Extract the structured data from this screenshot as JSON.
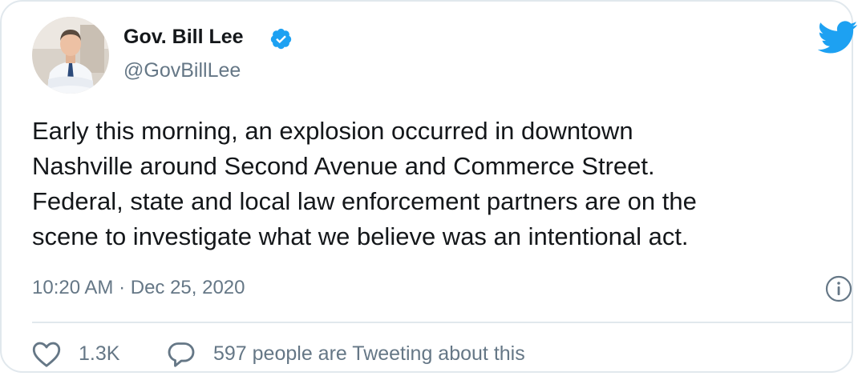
{
  "author": {
    "display_name": "Gov. Bill Lee",
    "handle": "@GovBillLee",
    "verified": true,
    "avatar_icon": "person-photo"
  },
  "tweet": {
    "text": "Early this morning, an explosion occurred in downtown\nNashville around Second Avenue and Commerce Street.\nFederal, state and local law enforcement partners are on the\nscene to investigate what we believe was an intentional act.",
    "timestamp": "10:20 AM · Dec 25, 2020"
  },
  "actions": {
    "like_count": "1.3K",
    "discussion_text": "597 people are Tweeting about this"
  },
  "icons": {
    "brand": "twitter-bird-icon",
    "verified": "verified-badge-icon",
    "info": "info-icon",
    "like": "heart-icon",
    "reply": "speech-bubble-icon"
  },
  "colors": {
    "brand_blue": "#1da1f2",
    "text_primary": "#14171a",
    "text_secondary": "#657786",
    "border": "#e1e8ed"
  }
}
